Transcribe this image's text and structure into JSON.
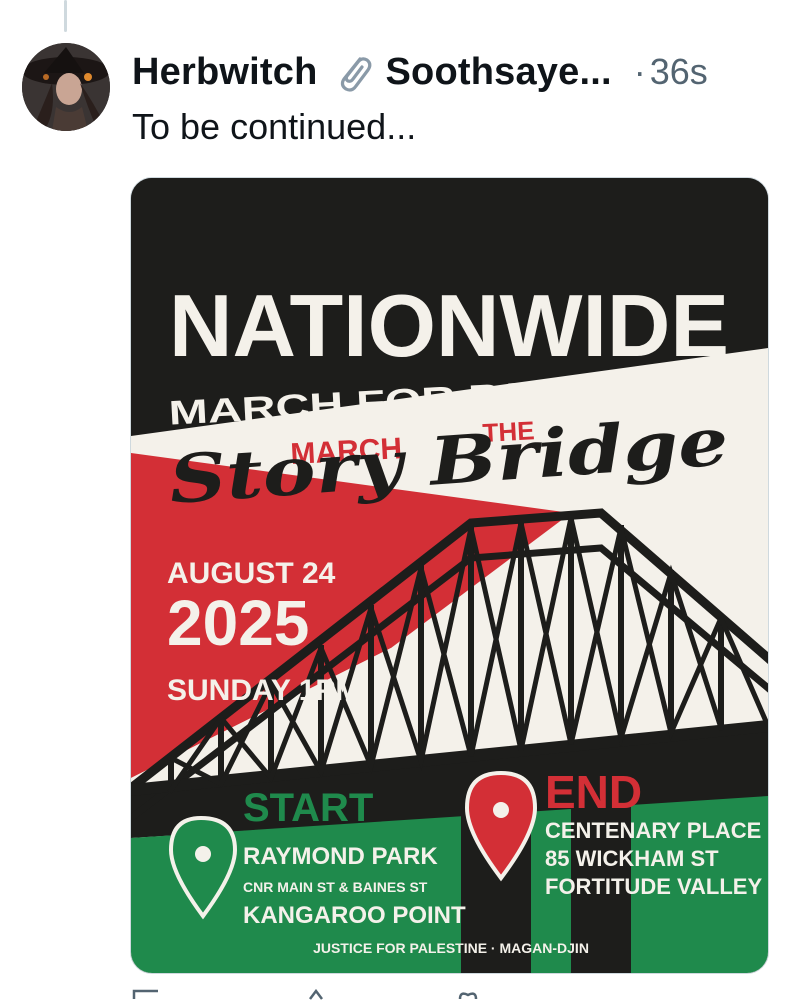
{
  "post": {
    "display_name": "Herbwitch",
    "badge_icon": "paperclip-icon",
    "second_name": "Soothsaye...",
    "separator": "·",
    "timestamp": "36s",
    "text": "To be continued..."
  },
  "poster": {
    "headline": "NATIONWIDE",
    "subhead": "MARCH FOR PALESTINE",
    "march_word": "MARCH",
    "the_word": "THE",
    "story_bridge": "Story Bridge",
    "date_line": "AUGUST 24",
    "year": "2025",
    "day_time": "SUNDAY 1PM",
    "start": {
      "label": "START",
      "line1": "RAYMOND PARK",
      "line2": "CNR MAIN ST & BAINES ST",
      "line3": "KANGAROO POINT"
    },
    "end": {
      "label": "END",
      "line1": "CENTENARY PLACE",
      "line2": "85 WICKHAM ST",
      "line3": "FORTITUDE VALLEY"
    },
    "footer": "JUSTICE FOR PALESTINE · MAGAN-DJIN",
    "colors": {
      "black": "#1d1d1b",
      "red": "#d32f36",
      "green": "#1f8a4c",
      "white": "#f4f1ea"
    }
  }
}
